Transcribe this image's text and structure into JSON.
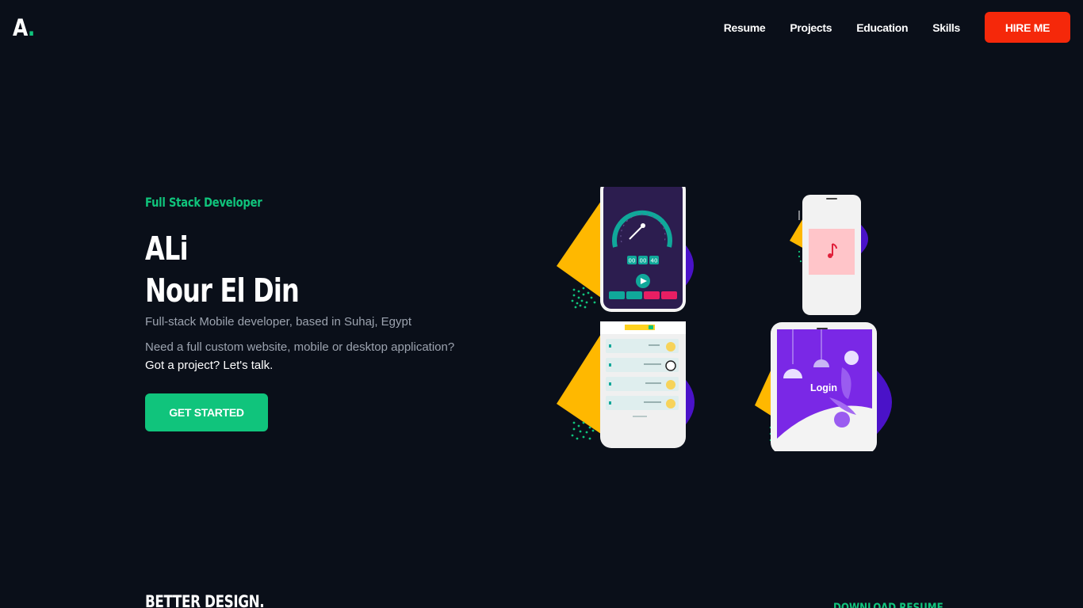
{
  "header": {
    "logo_letter": "A",
    "logo_dot": ".",
    "nav": [
      "Resume",
      "Projects",
      "Education",
      "Skills"
    ],
    "hire_label": "HIRE ME"
  },
  "hero": {
    "role": "Full Stack Developer",
    "name_line1": "ALi",
    "name_line2": "Nour El Din",
    "description": "Full-stack Mobile developer, based in Suhaj, Egypt",
    "pitch": "Need a full custom website, mobile or desktop application?",
    "cta_line": "Got a project? Let's talk.",
    "start_label": "GET STARTED"
  },
  "mockups": {
    "timer": {
      "digits": [
        "00",
        "00",
        "40"
      ]
    },
    "login_screen": {
      "label": "Login"
    }
  },
  "next_section": {
    "title": "BETTER DESIGN.",
    "download_label": "DOWNLOAD RESUME"
  },
  "colors": {
    "background": "#0a0f19",
    "accent_green": "#10c47c",
    "hire_red": "#f5280a",
    "shape_yellow": "#ffb800",
    "shape_purple": "#4a12c8"
  }
}
